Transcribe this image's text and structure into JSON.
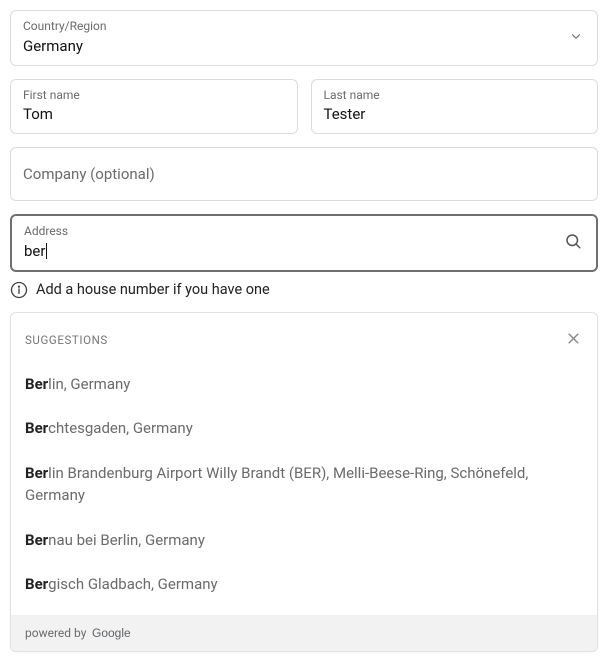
{
  "country": {
    "label": "Country/Region",
    "value": "Germany"
  },
  "first_name": {
    "label": "First name",
    "value": "Tom"
  },
  "last_name": {
    "label": "Last name",
    "value": "Tester"
  },
  "company": {
    "placeholder": "Company (optional)"
  },
  "address": {
    "label": "Address",
    "value": "ber"
  },
  "hint": "Add a house number if you have one",
  "suggestions": {
    "title": "SUGGESTIONS",
    "items": [
      {
        "match": "Ber",
        "rest": "lin, Germany"
      },
      {
        "match": "Ber",
        "rest": "chtesgaden, Germany"
      },
      {
        "match": "Ber",
        "rest": "lin Brandenburg Airport Willy Brandt (BER), Melli-Beese-Ring, Schönefeld, Germany"
      },
      {
        "match": "Ber",
        "rest": "nau bei Berlin, Germany"
      },
      {
        "match": "Ber",
        "rest": "gisch Gladbach, Germany"
      }
    ],
    "powered_prefix": "powered by"
  }
}
